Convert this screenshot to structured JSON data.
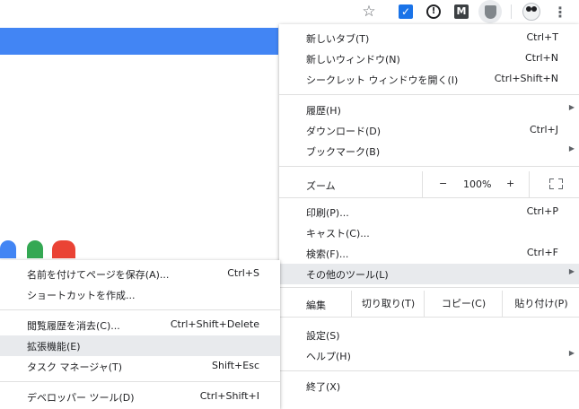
{
  "toolbar": {
    "star_icon": "star-outline-icon",
    "extensions": [
      "checkmark-extension-icon",
      "info-extension-icon",
      "m-extension-icon",
      "shield-extension-icon"
    ],
    "check_glyph": "✓",
    "info_glyph": "!",
    "m_glyph": "M",
    "menu_icon": "three-dot-menu-icon",
    "accent_color": "#1a73e8"
  },
  "page": {
    "bar_color": "#4285f4"
  },
  "main_menu": {
    "new_tab": {
      "label": "新しいタブ(T)",
      "shortcut": "Ctrl+T"
    },
    "new_window": {
      "label": "新しいウィンドウ(N)",
      "shortcut": "Ctrl+N"
    },
    "incognito": {
      "label": "シークレット ウィンドウを開く(I)",
      "shortcut": "Ctrl+Shift+N"
    },
    "history": {
      "label": "履歴(H)"
    },
    "downloads": {
      "label": "ダウンロード(D)",
      "shortcut": "Ctrl+J"
    },
    "bookmarks": {
      "label": "ブックマーク(B)"
    },
    "zoom": {
      "label": "ズーム",
      "minus": "−",
      "value": "100%",
      "plus": "+"
    },
    "print": {
      "label": "印刷(P)...",
      "shortcut": "Ctrl+P"
    },
    "cast": {
      "label": "キャスト(C)..."
    },
    "find": {
      "label": "検索(F)...",
      "shortcut": "Ctrl+F"
    },
    "more_tools": {
      "label": "その他のツール(L)"
    },
    "edit": {
      "label": "編集",
      "cut": "切り取り(T)",
      "copy": "コピー(C)",
      "paste": "貼り付け(P)"
    },
    "settings": {
      "label": "設定(S)"
    },
    "help": {
      "label": "ヘルプ(H)"
    },
    "exit": {
      "label": "終了(X)"
    }
  },
  "sub_menu": {
    "save_page": {
      "label": "名前を付けてページを保存(A)...",
      "shortcut": "Ctrl+S"
    },
    "create_shortcut": {
      "label": "ショートカットを作成..."
    },
    "clear_data": {
      "label": "閲覧履歴を消去(C)...",
      "shortcut": "Ctrl+Shift+Delete"
    },
    "extensions": {
      "label": "拡張機能(E)"
    },
    "task_manager": {
      "label": "タスク マネージャ(T)",
      "shortcut": "Shift+Esc"
    },
    "dev_tools": {
      "label": "デベロッパー ツール(D)",
      "shortcut": "Ctrl+Shift+I"
    }
  }
}
